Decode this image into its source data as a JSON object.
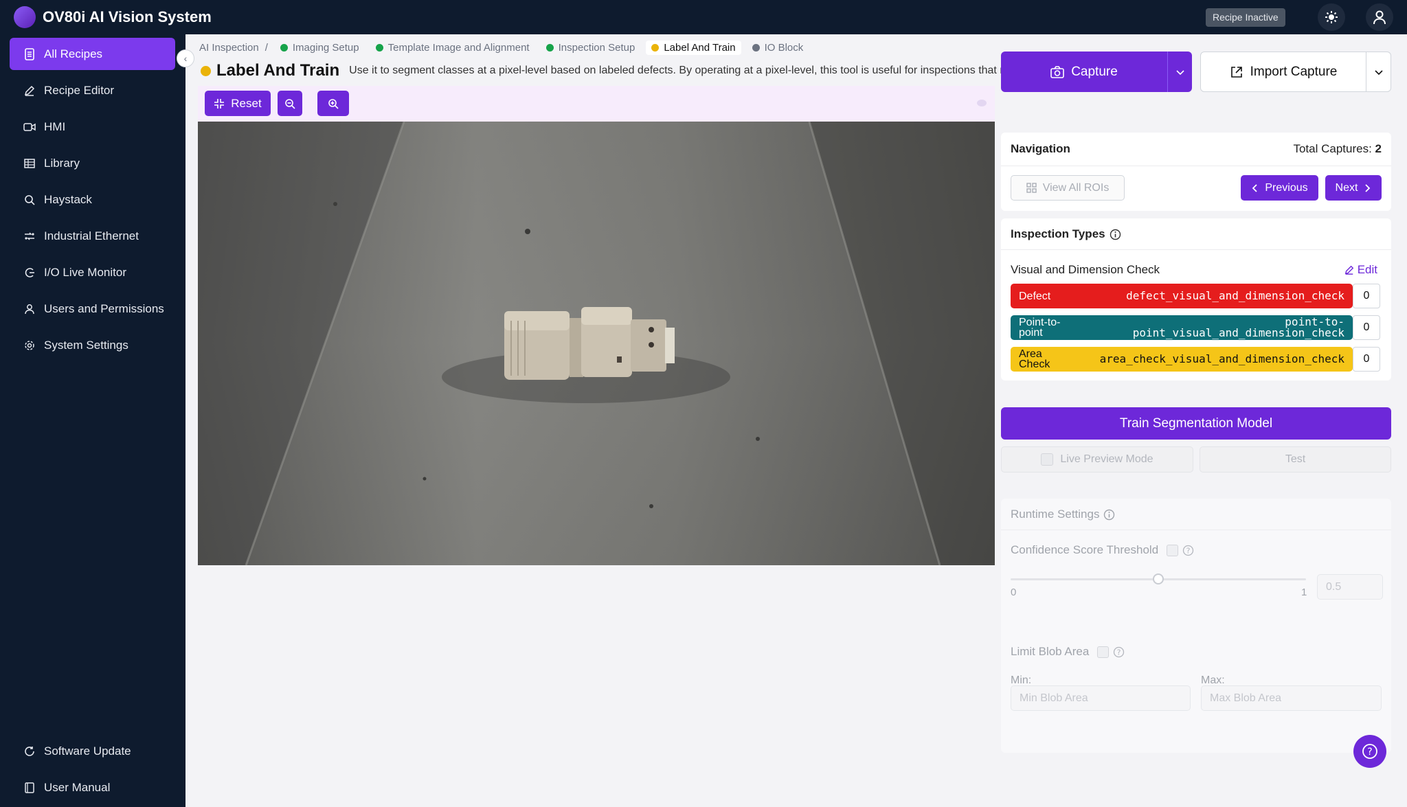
{
  "app": {
    "title": "OV80i AI Vision System",
    "recipe_status": "Recipe Inactive"
  },
  "sidebar": {
    "items": [
      {
        "label": "All Recipes",
        "icon": "document-icon"
      },
      {
        "label": "Recipe Editor",
        "icon": "pencil-icon"
      },
      {
        "label": "HMI",
        "icon": "video-icon"
      },
      {
        "label": "Library",
        "icon": "table-icon"
      },
      {
        "label": "Haystack",
        "icon": "search-icon"
      },
      {
        "label": "Industrial Ethernet",
        "icon": "network-icon"
      },
      {
        "label": "I/O Live Monitor",
        "icon": "monitor-icon"
      },
      {
        "label": "Users and Permissions",
        "icon": "user-icon"
      },
      {
        "label": "System Settings",
        "icon": "gear-icon"
      }
    ],
    "bottom": [
      {
        "label": "Software Update",
        "icon": "refresh-icon"
      },
      {
        "label": "User Manual",
        "icon": "book-icon"
      }
    ]
  },
  "breadcrumb": {
    "root": "AI Inspection",
    "separator": "/",
    "steps": [
      {
        "label": "Imaging Setup",
        "color": "#16a34a"
      },
      {
        "label": "Template Image and Alignment",
        "color": "#16a34a"
      },
      {
        "label": "Inspection Setup",
        "color": "#16a34a"
      },
      {
        "label": "Label And Train",
        "color": "#eab308"
      },
      {
        "label": "IO Block",
        "color": "#6b7280"
      }
    ]
  },
  "page": {
    "title": "Label And Train",
    "description": "Use it to segment classes at a pixel-level based on labeled defects. By operating at a pixel-level, this tool is useful for inspections that need finer grained control over labels."
  },
  "toolbar": {
    "reset_label": "Reset"
  },
  "capture": {
    "capture_label": "Capture",
    "import_label": "Import Capture"
  },
  "navigation": {
    "title": "Navigation",
    "total_label": "Total Captures:",
    "total_value": "2",
    "view_all": "View All ROIs",
    "previous": "Previous",
    "next": "Next"
  },
  "inspection_types": {
    "title": "Inspection Types",
    "group": "Visual and Dimension Check",
    "edit": "Edit",
    "classes": [
      {
        "name": "Defect",
        "key": "defect_visual_and_dimension_check",
        "count": "0",
        "color": "#e51d1d"
      },
      {
        "name": "Point-to-point",
        "key": "point-to-point_visual_and_dimension_check",
        "count": "0",
        "color": "#0e6f78"
      },
      {
        "name": "Area Check",
        "key": "area_check_visual_and_dimension_check",
        "count": "0",
        "color": "#f5c518"
      }
    ]
  },
  "train": {
    "label": "Train Segmentation Model",
    "live_preview": "Live Preview Mode",
    "test": "Test"
  },
  "runtime": {
    "title": "Runtime Settings",
    "confidence_label": "Confidence Score Threshold",
    "slider_min": "0",
    "slider_max": "1",
    "slider_value": "0.5",
    "limit_blob": "Limit Blob Area",
    "min_label": "Min:",
    "max_label": "Max:",
    "min_placeholder": "Min Blob Area",
    "max_placeholder": "Max Blob Area"
  },
  "colors": {
    "accent": "#6d28d9",
    "sidebar": "#0e1b2e"
  }
}
